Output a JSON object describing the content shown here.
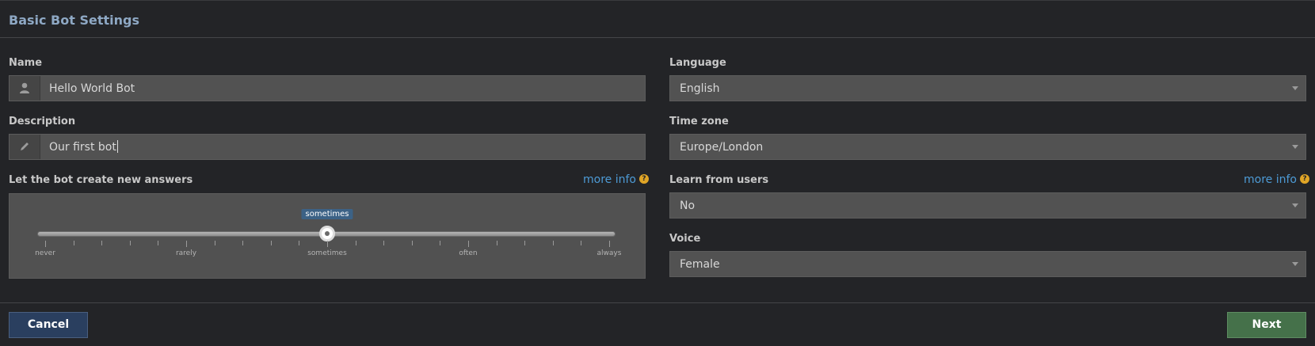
{
  "header": {
    "title": "Basic Bot Settings"
  },
  "left": {
    "name": {
      "label": "Name",
      "value": "Hello World Bot",
      "icon": "user-icon"
    },
    "description": {
      "label": "Description",
      "value": "Our first bot",
      "icon": "pencil-icon"
    },
    "create_answers": {
      "label": "Let the bot create new answers",
      "more_info": "more info",
      "slider": {
        "current": "sometimes",
        "current_fraction": 0.5,
        "labels": [
          "never",
          "rarely",
          "sometimes",
          "often",
          "always"
        ]
      }
    }
  },
  "right": {
    "language": {
      "label": "Language",
      "value": "English"
    },
    "timezone": {
      "label": "Time zone",
      "value": "Europe/London"
    },
    "learn": {
      "label": "Learn from users",
      "value": "No",
      "more_info": "more info"
    },
    "voice": {
      "label": "Voice",
      "value": "Female"
    }
  },
  "footer": {
    "cancel_label": "Cancel",
    "next_label": "Next"
  },
  "colors": {
    "accent": "#4d9bd6",
    "cancel": "#2a3f5f",
    "next": "#45714a",
    "help": "#e0a526"
  }
}
